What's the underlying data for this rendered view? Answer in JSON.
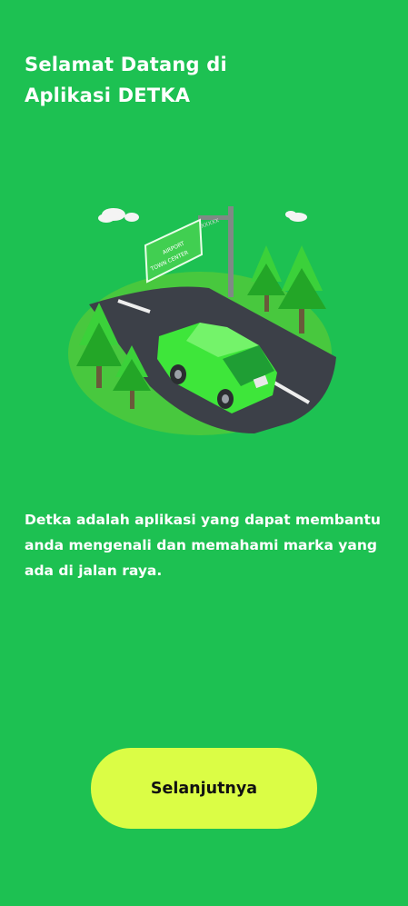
{
  "welcome": {
    "title_line1": "Selamat Datang di",
    "title_line2": "Aplikasi DETKA"
  },
  "illustration": {
    "sign_lines": [
      "AIRPORT",
      "TOWN CENTER"
    ],
    "sign_top_label": "XXXXX",
    "colors": {
      "background": "#1dc152",
      "ground": "#48c83e",
      "road": "#3c4048",
      "car": "#3ee63a",
      "tree": "#3bd13a",
      "tree_dark": "#23a627",
      "sign": "#41cf51",
      "pole": "#7f8a85"
    }
  },
  "description": {
    "text": "Detka adalah aplikasi yang dapat membantu anda mengenali dan memahami marka yang ada di jalan raya."
  },
  "actions": {
    "next_label": "Selanjutnya",
    "next_color": "#dbfd45"
  }
}
